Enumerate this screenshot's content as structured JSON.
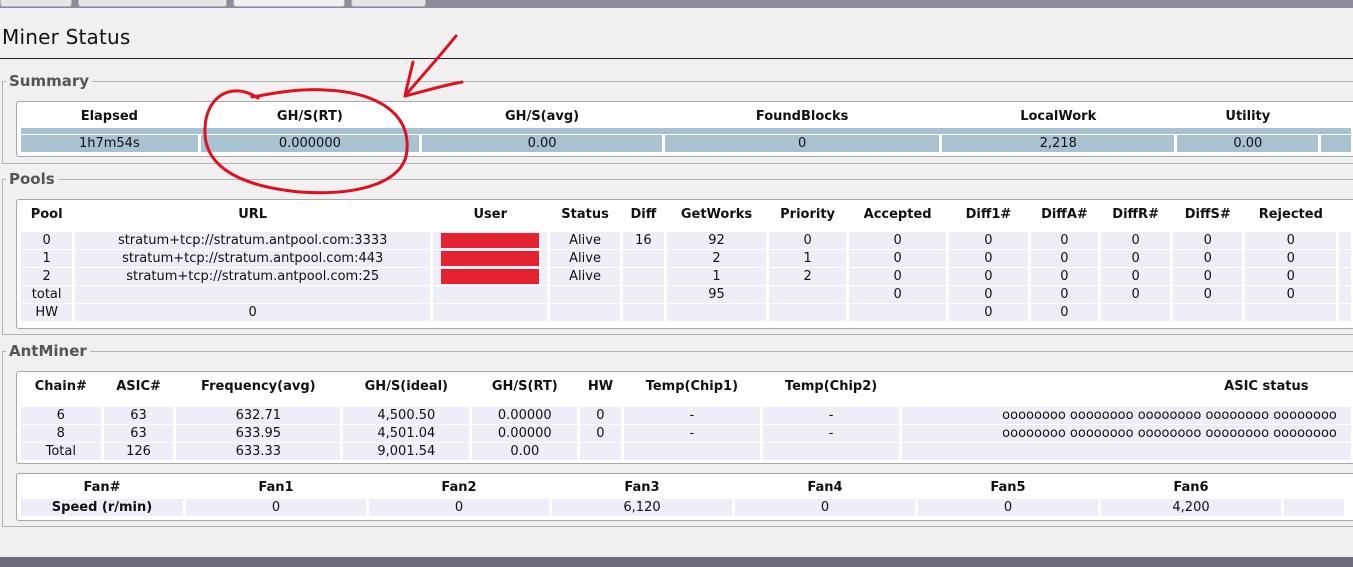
{
  "page": {
    "title": "Miner Status"
  },
  "summary": {
    "legend": "Summary",
    "headers": [
      "Elapsed",
      "GH/S(RT)",
      "GH/S(avg)",
      "FoundBlocks",
      "LocalWork",
      "Utility"
    ],
    "values": [
      "1h7m54s",
      "0.000000",
      "0.00",
      "0",
      "2,218",
      "0.00"
    ]
  },
  "pools": {
    "legend": "Pools",
    "headers": [
      "Pool",
      "URL",
      "User",
      "Status",
      "Diff",
      "GetWorks",
      "Priority",
      "Accepted",
      "Diff1#",
      "DiffA#",
      "DiffR#",
      "DiffS#",
      "Rejected"
    ],
    "rows": [
      [
        "0",
        "stratum+tcp://stratum.antpool.com:3333",
        "",
        "Alive",
        "16",
        "92",
        "0",
        "0",
        "0",
        "0",
        "0",
        "0",
        "0"
      ],
      [
        "1",
        "stratum+tcp://stratum.antpool.com:443",
        "",
        "Alive",
        "",
        "2",
        "1",
        "0",
        "0",
        "0",
        "0",
        "0",
        "0"
      ],
      [
        "2",
        "stratum+tcp://stratum.antpool.com:25",
        "",
        "Alive",
        "",
        "1",
        "2",
        "0",
        "0",
        "0",
        "0",
        "0",
        "0"
      ],
      [
        "total",
        "",
        "",
        "",
        "",
        "95",
        "",
        "0",
        "0",
        "0",
        "0",
        "0",
        "0"
      ],
      [
        "HW",
        "0",
        "",
        "",
        "",
        "",
        "",
        "",
        "0",
        "0",
        "",
        "",
        ""
      ]
    ]
  },
  "antminer": {
    "legend": "AntMiner",
    "headers": [
      "Chain#",
      "ASIC#",
      "Frequency(avg)",
      "GH/S(ideal)",
      "GH/S(RT)",
      "HW",
      "Temp(Chip1)",
      "Temp(Chip2)",
      "ASIC status"
    ],
    "rows": [
      [
        "6",
        "63",
        "632.71",
        "4,500.50",
        "0.00000",
        "0",
        "-",
        "-",
        "oooooooo oooooooo oooooooo oooooooo oooooooo"
      ],
      [
        "8",
        "63",
        "633.95",
        "4,501.04",
        "0.00000",
        "0",
        "-",
        "-",
        "oooooooo oooooooo oooooooo oooooooo oooooooo"
      ],
      [
        "Total",
        "126",
        "633.33",
        "9,001.54",
        "0.00",
        "",
        "",
        "",
        ""
      ]
    ]
  },
  "fans": {
    "headers": [
      "Fan#",
      "Fan1",
      "Fan2",
      "Fan3",
      "Fan4",
      "Fan5",
      "Fan6"
    ],
    "speed_label": "Speed (r/min)",
    "speeds": [
      "0",
      "0",
      "6,120",
      "0",
      "0",
      "4,200"
    ]
  },
  "colors": {
    "selected_row": "#a9c2d2",
    "light_row": "#eeeef8",
    "annotation": "#e01020",
    "redaction": "#e5222f"
  }
}
